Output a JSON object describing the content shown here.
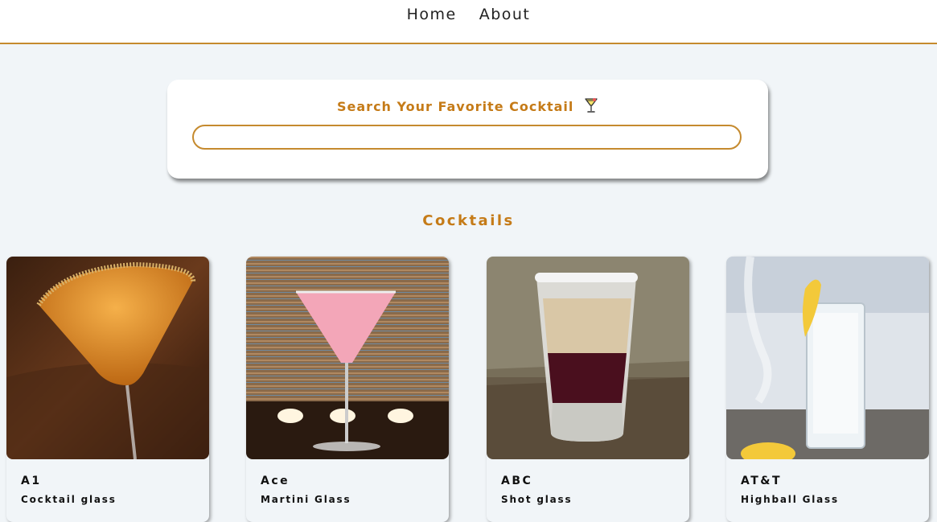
{
  "nav": {
    "home_label": "Home",
    "about_label": "About"
  },
  "search": {
    "title": "Search Your Favorite Cocktail",
    "icon": "tropical-drink-icon",
    "value": "",
    "placeholder": ""
  },
  "section": {
    "title": "Cocktails"
  },
  "cocktails": [
    {
      "name": "A1",
      "glass": "Cocktail glass"
    },
    {
      "name": "Ace",
      "glass": "Martini Glass"
    },
    {
      "name": "ABC",
      "glass": "Shot glass"
    },
    {
      "name": "AT&T",
      "glass": "Highball Glass"
    }
  ],
  "colors": {
    "accent": "#c57b18",
    "border": "#c58a2e",
    "background": "#f1f5f8"
  }
}
